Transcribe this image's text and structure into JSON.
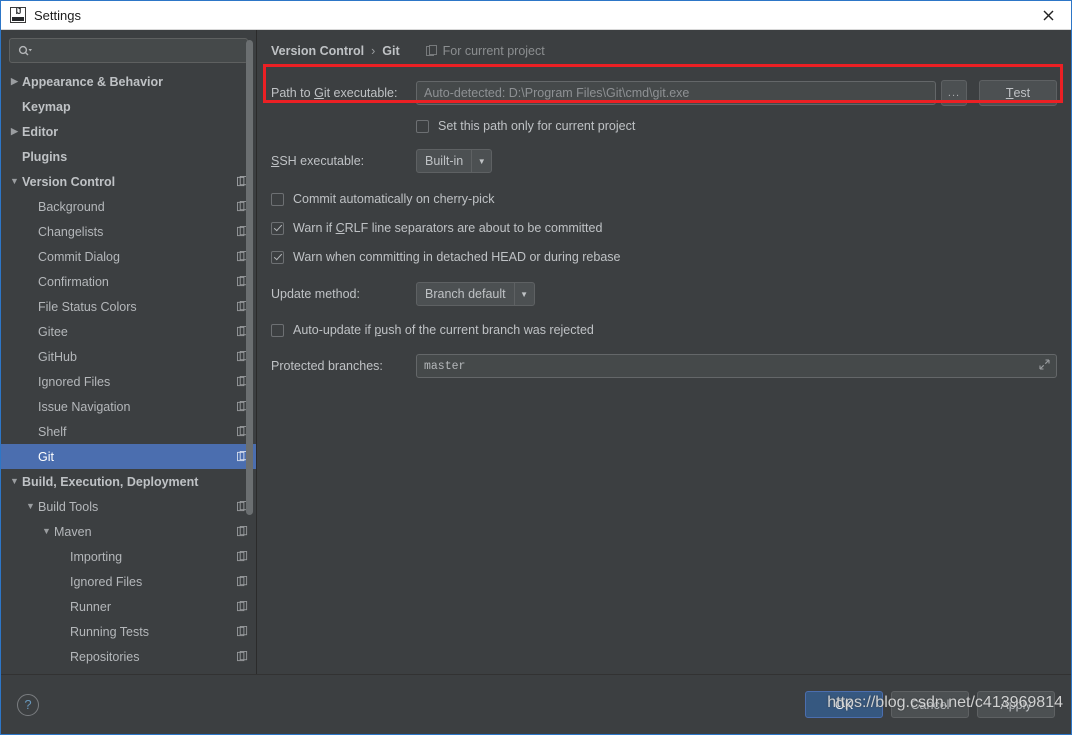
{
  "window": {
    "title": "Settings",
    "app_icon": "intellij-idea-icon",
    "close_icon": "close-icon"
  },
  "sidebar": {
    "search": {
      "value": "",
      "placeholder": "",
      "icon": "search-icon"
    },
    "items": [
      {
        "label": "Appearance & Behavior",
        "indent": 0,
        "twisty": "collapsed",
        "bold": true,
        "project_icon": false,
        "selected": false
      },
      {
        "label": "Keymap",
        "indent": 0,
        "twisty": "none",
        "bold": true,
        "project_icon": false,
        "selected": false
      },
      {
        "label": "Editor",
        "indent": 0,
        "twisty": "collapsed",
        "bold": true,
        "project_icon": false,
        "selected": false
      },
      {
        "label": "Plugins",
        "indent": 0,
        "twisty": "none",
        "bold": true,
        "project_icon": false,
        "selected": false
      },
      {
        "label": "Version Control",
        "indent": 0,
        "twisty": "expanded",
        "bold": true,
        "project_icon": true,
        "selected": false
      },
      {
        "label": "Background",
        "indent": 1,
        "twisty": "none",
        "bold": false,
        "project_icon": true,
        "selected": false
      },
      {
        "label": "Changelists",
        "indent": 1,
        "twisty": "none",
        "bold": false,
        "project_icon": true,
        "selected": false
      },
      {
        "label": "Commit Dialog",
        "indent": 1,
        "twisty": "none",
        "bold": false,
        "project_icon": true,
        "selected": false
      },
      {
        "label": "Confirmation",
        "indent": 1,
        "twisty": "none",
        "bold": false,
        "project_icon": true,
        "selected": false
      },
      {
        "label": "File Status Colors",
        "indent": 1,
        "twisty": "none",
        "bold": false,
        "project_icon": true,
        "selected": false
      },
      {
        "label": "Gitee",
        "indent": 1,
        "twisty": "none",
        "bold": false,
        "project_icon": true,
        "selected": false
      },
      {
        "label": "GitHub",
        "indent": 1,
        "twisty": "none",
        "bold": false,
        "project_icon": true,
        "selected": false
      },
      {
        "label": "Ignored Files",
        "indent": 1,
        "twisty": "none",
        "bold": false,
        "project_icon": true,
        "selected": false
      },
      {
        "label": "Issue Navigation",
        "indent": 1,
        "twisty": "none",
        "bold": false,
        "project_icon": true,
        "selected": false
      },
      {
        "label": "Shelf",
        "indent": 1,
        "twisty": "none",
        "bold": false,
        "project_icon": true,
        "selected": false
      },
      {
        "label": "Git",
        "indent": 1,
        "twisty": "none",
        "bold": false,
        "project_icon": true,
        "selected": true
      },
      {
        "label": "Build, Execution, Deployment",
        "indent": 0,
        "twisty": "expanded",
        "bold": true,
        "project_icon": false,
        "selected": false
      },
      {
        "label": "Build Tools",
        "indent": 1,
        "twisty": "expanded",
        "bold": false,
        "project_icon": true,
        "selected": false
      },
      {
        "label": "Maven",
        "indent": 2,
        "twisty": "expanded",
        "bold": false,
        "project_icon": true,
        "selected": false
      },
      {
        "label": "Importing",
        "indent": 3,
        "twisty": "none",
        "bold": false,
        "project_icon": true,
        "selected": false
      },
      {
        "label": "Ignored Files",
        "indent": 3,
        "twisty": "none",
        "bold": false,
        "project_icon": true,
        "selected": false
      },
      {
        "label": "Runner",
        "indent": 3,
        "twisty": "none",
        "bold": false,
        "project_icon": true,
        "selected": false
      },
      {
        "label": "Running Tests",
        "indent": 3,
        "twisty": "none",
        "bold": false,
        "project_icon": true,
        "selected": false
      },
      {
        "label": "Repositories",
        "indent": 3,
        "twisty": "none",
        "bold": false,
        "project_icon": true,
        "selected": false
      }
    ]
  },
  "breadcrumb": {
    "root": "Version Control",
    "separator": "›",
    "current": "Git",
    "scope_label": "For current project",
    "scope_icon": "project-scope-icon"
  },
  "git_settings": {
    "path_label_before": "Path to ",
    "path_label_mnemonic": "G",
    "path_label_after": "it executable:",
    "path_value": "",
    "path_placeholder": "Auto-detected: D:\\Program Files\\Git\\cmd\\git.exe",
    "browse_button": "...",
    "test_button_mnemonic": "T",
    "test_button_after": "est",
    "set_path_current_project": {
      "label": "Set this path only for current project",
      "checked": false
    },
    "ssh_label_mnemonic": "S",
    "ssh_label_after": "SH executable:",
    "ssh_value": "Built-in",
    "commit_cherry_pick": {
      "label": "Commit automatically on cherry-pick",
      "checked": false
    },
    "warn_crlf_before": "Warn if ",
    "warn_crlf_mnemonic": "C",
    "warn_crlf_after": "RLF line separators are about to be committed",
    "warn_crlf_checked": true,
    "warn_detached": {
      "label": "Warn when committing in detached HEAD or during rebase",
      "checked": true
    },
    "update_method_label": "Update method:",
    "update_method_value": "Branch default",
    "auto_update_before": "Auto-update if ",
    "auto_update_mnemonic": "p",
    "auto_update_after": "ush of the current branch was rejected",
    "auto_update_checked": false,
    "protected_branches_label": "Protected branches:",
    "protected_branches_value": "master",
    "expand_icon": "expand-icon",
    "dropdown_icon": "chevron-down-icon",
    "highlight_color": "#ec2024"
  },
  "footer": {
    "help_label": "?",
    "ok_label": "OK",
    "cancel_label": "Cancel",
    "apply_label": "Apply",
    "watermark": "https://blog.csdn.net/c413969814"
  }
}
